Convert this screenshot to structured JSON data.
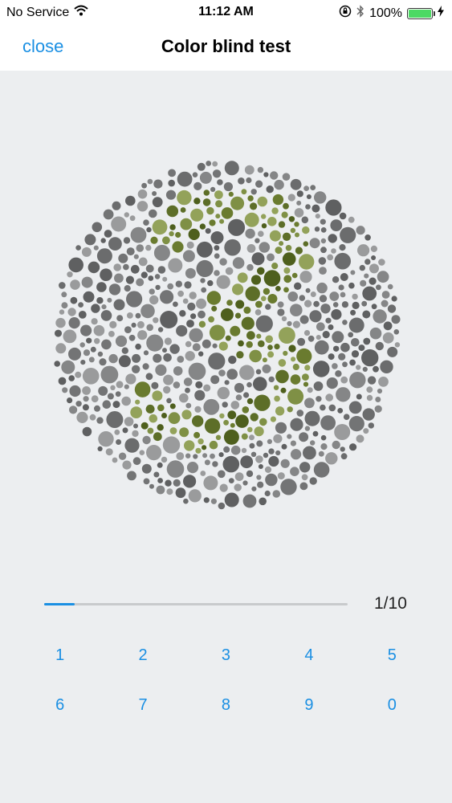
{
  "status_bar": {
    "carrier": "No Service",
    "time": "11:12 AM",
    "battery_percent": "100%",
    "battery_level": 1.0,
    "icons": [
      "wifi-icon",
      "rotation-lock-icon",
      "bluetooth-icon",
      "battery-icon",
      "charging-icon"
    ]
  },
  "nav": {
    "close_label": "close",
    "title": "Color blind test"
  },
  "test": {
    "plate_digit": "2",
    "progress_label": "1/10",
    "progress_fraction": 0.1
  },
  "keypad": {
    "keys": [
      "1",
      "2",
      "3",
      "4",
      "5",
      "6",
      "7",
      "8",
      "9",
      "0"
    ]
  },
  "colors": {
    "accent": "#1a8fe3",
    "background": "#eceef0",
    "dot_grays": [
      "#5f6061",
      "#737475",
      "#858687",
      "#9a9b9c",
      "#6b6c6d"
    ],
    "dot_greens": [
      "#4e5f1d",
      "#6a7b2f",
      "#7f9045",
      "#93a25a",
      "#5d6e28"
    ]
  }
}
